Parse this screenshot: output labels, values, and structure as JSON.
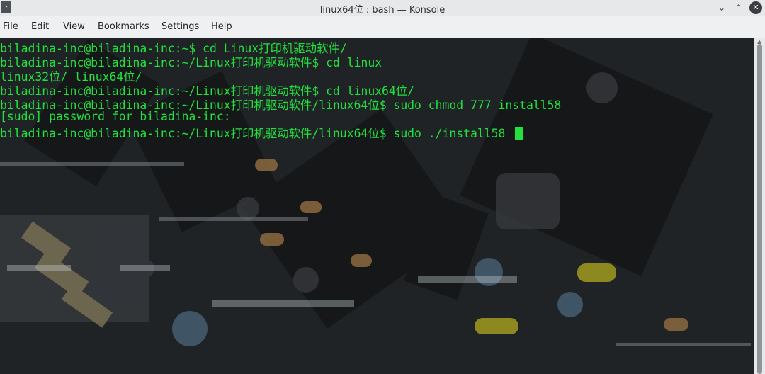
{
  "window": {
    "title": "linux64位 : bash — Konsole",
    "icon_glyph": "›",
    "controls": {
      "minimize": "⌄",
      "maximize": "⌃",
      "close": "✕"
    }
  },
  "menu": [
    "File",
    "Edit",
    "View",
    "Bookmarks",
    "Settings",
    "Help"
  ],
  "terminal": {
    "lines": [
      "biladina-inc@biladina-inc:~$ cd Linux打印机驱动软件/",
      "biladina-inc@biladina-inc:~/Linux打印机驱动软件$ cd linux",
      "linux32位/ linux64位/",
      "biladina-inc@biladina-inc:~/Linux打印机驱动软件$ cd linux64位/",
      "biladina-inc@biladina-inc:~/Linux打印机驱动软件/linux64位$ sudo chmod 777 install58",
      "[sudo] password for biladina-inc:",
      "biladina-inc@biladina-inc:~/Linux打印机驱动软件/linux64位$ sudo ./install58 "
    ],
    "text_color": "#22e13f",
    "background_description_icon": "circuit-board-background"
  }
}
